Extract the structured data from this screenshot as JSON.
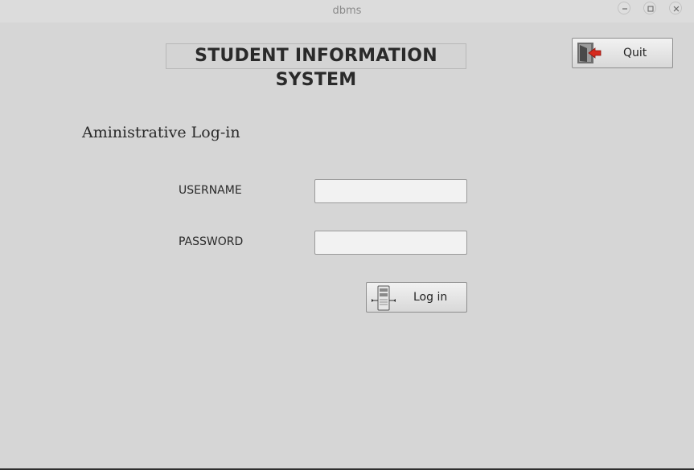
{
  "window": {
    "title": "dbms",
    "minimize_icon": "minimize-icon",
    "maximize_icon": "maximize-icon",
    "close_icon": "close-icon"
  },
  "app": {
    "title": "STUDENT INFORMATION SYSTEM",
    "quit_label": "Quit",
    "quit_icon": "exit-door-icon"
  },
  "form": {
    "heading": "Aministrative Log-in",
    "username_label": "USERNAME",
    "username_value": "",
    "password_label": "PASSWORD",
    "password_value": "",
    "login_label": "Log in",
    "login_icon": "server-icon"
  }
}
